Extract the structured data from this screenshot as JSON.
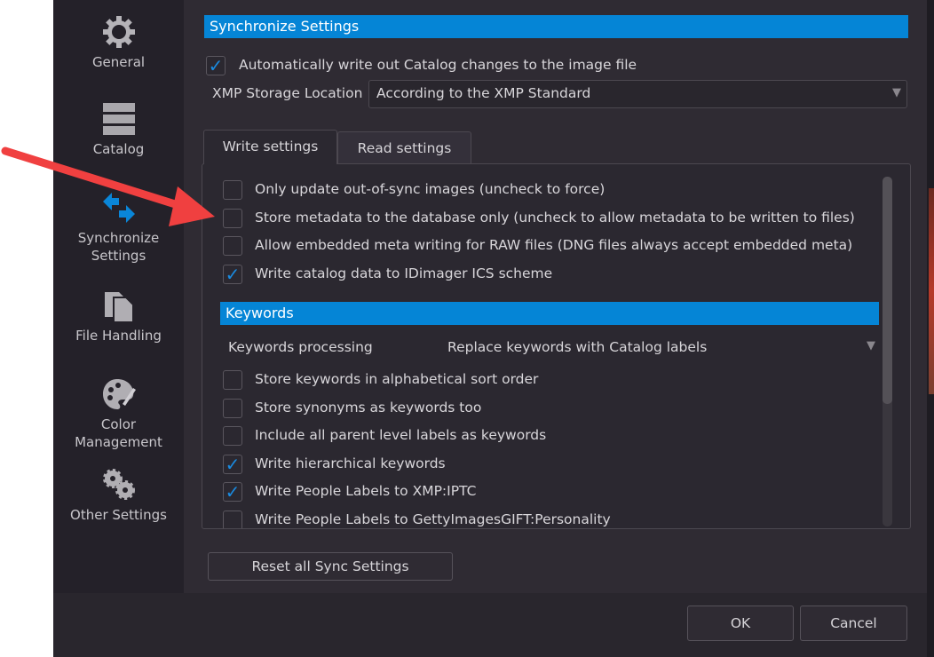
{
  "sidebar": {
    "items": [
      {
        "label": "General",
        "icon": "gear-icon"
      },
      {
        "label": "Catalog",
        "icon": "catalog-icon"
      },
      {
        "label": "Synchronize Settings",
        "line1": "Synchronize",
        "line2": "Settings",
        "icon": "sync-arrows-icon",
        "active": true
      },
      {
        "label": "File Handling",
        "icon": "files-icon"
      },
      {
        "label": "Color Management",
        "line1": "Color",
        "line2": "Management",
        "icon": "palette-icon"
      },
      {
        "label": "Other Settings",
        "icon": "gears-icon"
      }
    ]
  },
  "sync": {
    "header": "Synchronize Settings",
    "auto_write": {
      "label": "Automatically write out Catalog changes to the image file",
      "checked": true
    },
    "xmp_label": "XMP Storage Location",
    "xmp_value": "According to the XMP Standard"
  },
  "tabs": [
    {
      "label": "Write settings",
      "active": true
    },
    {
      "label": "Read settings",
      "active": false
    }
  ],
  "write_options": [
    {
      "label": "Only update out-of-sync images (uncheck to force)",
      "checked": false
    },
    {
      "label": "Store metadata to the database only (uncheck to allow metadata to be written to files)",
      "checked": false
    },
    {
      "label": "Allow embedded meta writing for RAW files (DNG files always accept embedded meta)",
      "checked": false
    },
    {
      "label": "Write catalog data to IDimager ICS scheme",
      "checked": true
    }
  ],
  "keywords": {
    "header": "Keywords",
    "processing_label": "Keywords processing",
    "processing_value": "Replace keywords with Catalog labels",
    "options": [
      {
        "label": "Store keywords in alphabetical sort order",
        "checked": false
      },
      {
        "label": "Store synonyms as keywords too",
        "checked": false
      },
      {
        "label": "Include all parent level labels as keywords",
        "checked": false
      },
      {
        "label": "Write hierarchical keywords",
        "checked": true
      },
      {
        "label": "Write People Labels to XMP:IPTC",
        "checked": true
      },
      {
        "label": "Write People Labels to GettyImagesGIFT:Personality",
        "checked": false
      }
    ]
  },
  "buttons": {
    "reset": "Reset all Sync Settings",
    "ok": "OK",
    "cancel": "Cancel"
  },
  "colors": {
    "accent": "#0585d6",
    "annotation_arrow": "#f04040"
  }
}
